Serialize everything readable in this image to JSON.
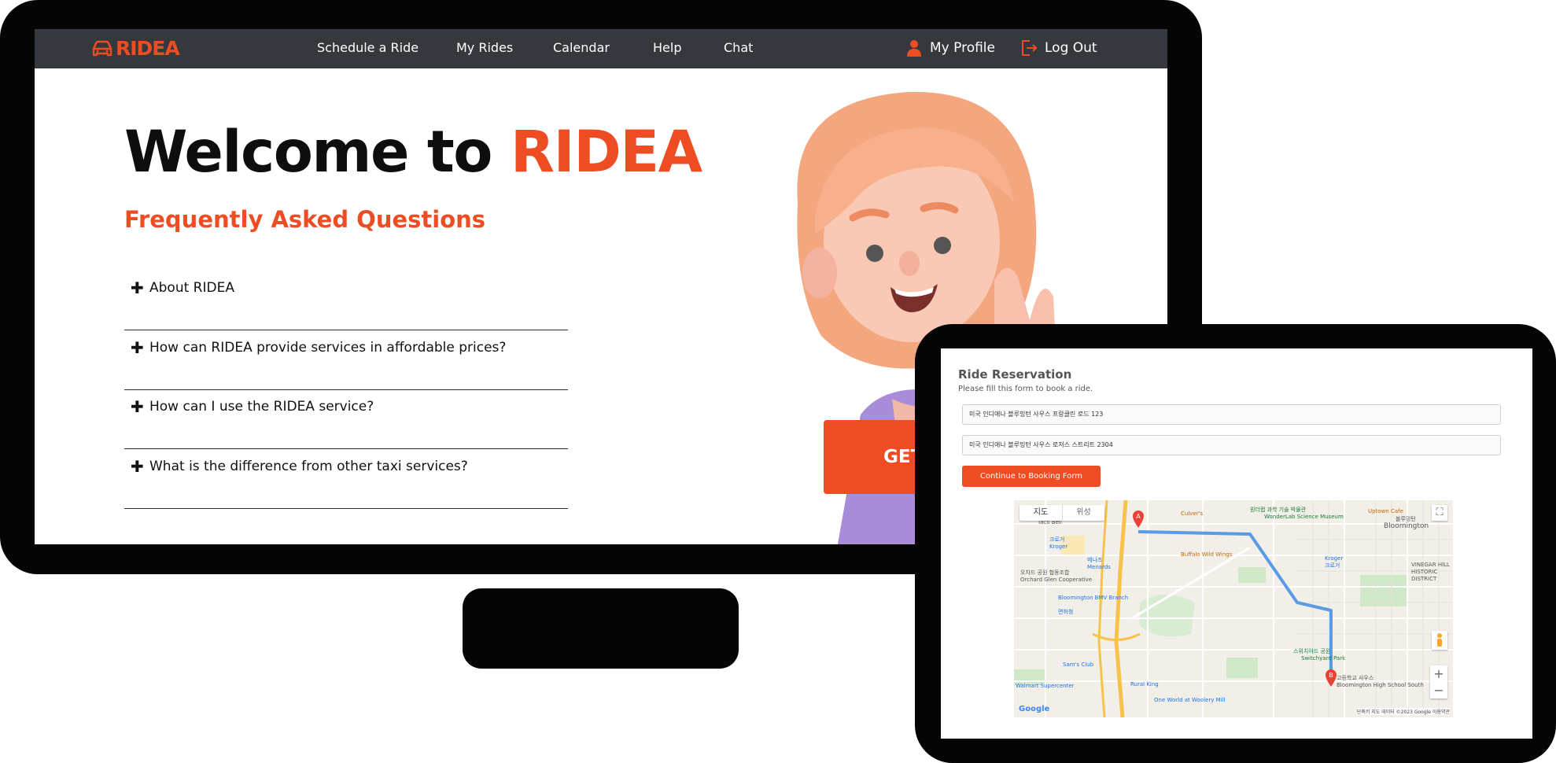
{
  "brand": {
    "name": "RIDEA",
    "accent_color": "#ee4d23",
    "icon": "car-icon"
  },
  "nav": {
    "links": [
      "Schedule a Ride",
      "My Rides",
      "Calendar",
      "Help",
      "Chat"
    ],
    "profile": {
      "label": "My Profile",
      "icon": "user-icon"
    },
    "logout": {
      "label": "Log Out",
      "icon": "logout-icon"
    }
  },
  "hero": {
    "title_prefix": "Welcome to ",
    "title_brand": "RIDEA",
    "faq_heading": "Frequently Asked Questions",
    "cta_label": "GET"
  },
  "faq": [
    "About RIDEA",
    "How can RIDEA provide services in affordable prices?",
    "How can I use the RIDEA service?",
    "What is the difference from other taxi services?"
  ],
  "reservation": {
    "title": "Ride Reservation",
    "subtitle": "Please fill this form to book a ride.",
    "pickup_value": "미국 인디애나 블루밍턴 사우스 프랑클린 로드 123",
    "dropoff_value": "미국 인디애나 블루밍턴 사우스 로저스 스트리트 2304",
    "continue_label": "Continue to Booking Form"
  },
  "map": {
    "view_map": "지도",
    "view_satellite": "위성",
    "marker_a": "A",
    "marker_b": "B",
    "zoom_in": "+",
    "zoom_out": "−",
    "attribution": "단축키 지도 데이터 ©2023 Google 이용약관",
    "google": "Google",
    "places": {
      "wonderlab": "원더랩 과학 기술 박물관",
      "wonderlab_en": "WonderLab Science Museum",
      "uptown": "Uptown Cafe",
      "bloomington_ko": "블루밍턴",
      "bloomington": "Bloomington",
      "culvers": "Culver's",
      "kroger1_ko": "크로거",
      "kroger1": "Kroger",
      "menards_ko": "메나즈",
      "menards": "Menards",
      "buffalo": "Buffalo Wild Wings",
      "orchard_ko": "오차드 공원 협동조합",
      "orchard": "Orchard Glen Cooperative",
      "bmv": "Bloomington BMV Branch",
      "bmv_ko": "면허청",
      "kroger2": "Kroger",
      "kroger2_ko": "크로거",
      "switchyard_ko": "스위치야드 공원",
      "switchyard": "Switchyard Park",
      "highschool_ko": "고등학교 사우스",
      "highschool": "Bloomington High School South",
      "samsclub": "Sam's Club",
      "walmart": "Walmart Supercenter",
      "ruralking": "Rural King",
      "oneworld": "One World at Woolery Mill",
      "vinegar": "VINEGAR HILL HISTORIC DISTRICT",
      "tacobell": "Taco Bell"
    }
  }
}
